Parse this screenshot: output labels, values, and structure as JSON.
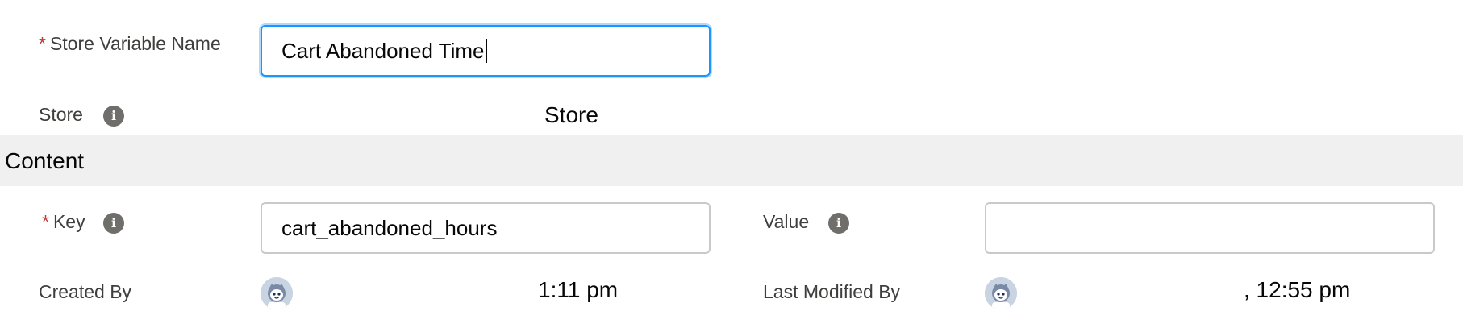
{
  "fields": {
    "store_variable_name": {
      "label": "Store Variable Name",
      "required_marker": "*",
      "value": "Cart Abandoned Time"
    },
    "store": {
      "label": "Store",
      "value": "Store"
    }
  },
  "section": {
    "title": "Content"
  },
  "content": {
    "key": {
      "label": "Key",
      "required_marker": "*",
      "value": "cart_abandoned_hours"
    },
    "value": {
      "label": "Value",
      "value": ""
    }
  },
  "audit": {
    "created_by": {
      "label": "Created By",
      "timestamp": "1:11 pm"
    },
    "last_modified_by": {
      "label": "Last Modified By",
      "timestamp": ", 12:55 pm"
    }
  },
  "icons": {
    "info": "i"
  },
  "colors": {
    "required": "#c23934",
    "focus_border": "#1b96ff",
    "section_bg": "#f0f0f0",
    "info_icon_bg": "#706e6b"
  }
}
